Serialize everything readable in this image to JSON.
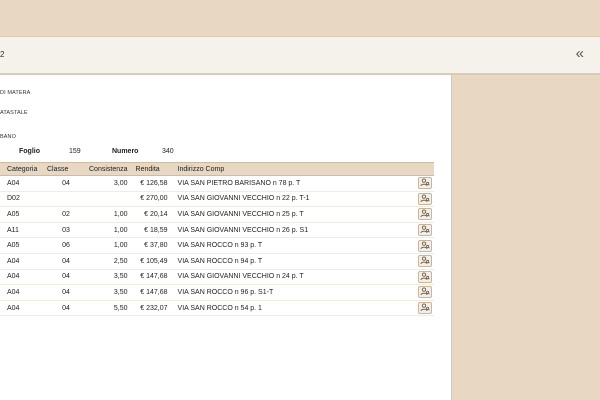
{
  "toolbar": {
    "page_number": "2",
    "collapse_symbol": "«"
  },
  "info": {
    "line1": "DI MATERA",
    "line2": "ATASTALE",
    "line3": "BANO"
  },
  "foglio": {
    "label": "Foglio",
    "value": "159"
  },
  "numero": {
    "label": "Numero",
    "value": "340"
  },
  "table": {
    "headers": [
      "Categoria",
      "Classe",
      "Consistenza",
      "Rendita",
      "Indirizzo Comp"
    ],
    "rows": [
      {
        "categoria": "A04",
        "classe": "04",
        "consistenza": "3,00",
        "rendita": "€ 126,58",
        "indirizzo": "VIA SAN PIETRO BARISANO n 78 p. T"
      },
      {
        "categoria": "D02",
        "classe": "",
        "consistenza": "",
        "rendita": "€ 270,00",
        "indirizzo": "VIA SAN GIOVANNI VECCHIO n 22 p. T-1"
      },
      {
        "categoria": "A05",
        "classe": "02",
        "consistenza": "1,00",
        "rendita": "€ 20,14",
        "indirizzo": "VIA SAN GIOVANNI VECCHIO n 25 p. T"
      },
      {
        "categoria": "A11",
        "classe": "03",
        "consistenza": "1,00",
        "rendita": "€ 18,59",
        "indirizzo": "VIA SAN GIOVANNI VECCHIO n 26 p. S1"
      },
      {
        "categoria": "A05",
        "classe": "06",
        "consistenza": "1,00",
        "rendita": "€ 37,80",
        "indirizzo": "VIA SAN ROCCO n 93 p. T"
      },
      {
        "categoria": "A04",
        "classe": "04",
        "consistenza": "2,50",
        "rendita": "€ 105,49",
        "indirizzo": "VIA SAN ROCCO n 94 p. T"
      },
      {
        "categoria": "A04",
        "classe": "04",
        "consistenza": "3,50",
        "rendita": "€ 147,68",
        "indirizzo": "VIA SAN GIOVANNI VECCHIO n 24 p. T"
      },
      {
        "categoria": "A04",
        "classe": "04",
        "consistenza": "3,50",
        "rendita": "€ 147,68",
        "indirizzo": "VIA SAN ROCCO n 96 p. S1-T"
      },
      {
        "categoria": "A04",
        "classe": "04",
        "consistenza": "5,50",
        "rendita": "€ 232,07",
        "indirizzo": "VIA SAN ROCCO n 54 p. 1"
      }
    ],
    "row_action_icon": "person-search-icon"
  }
}
